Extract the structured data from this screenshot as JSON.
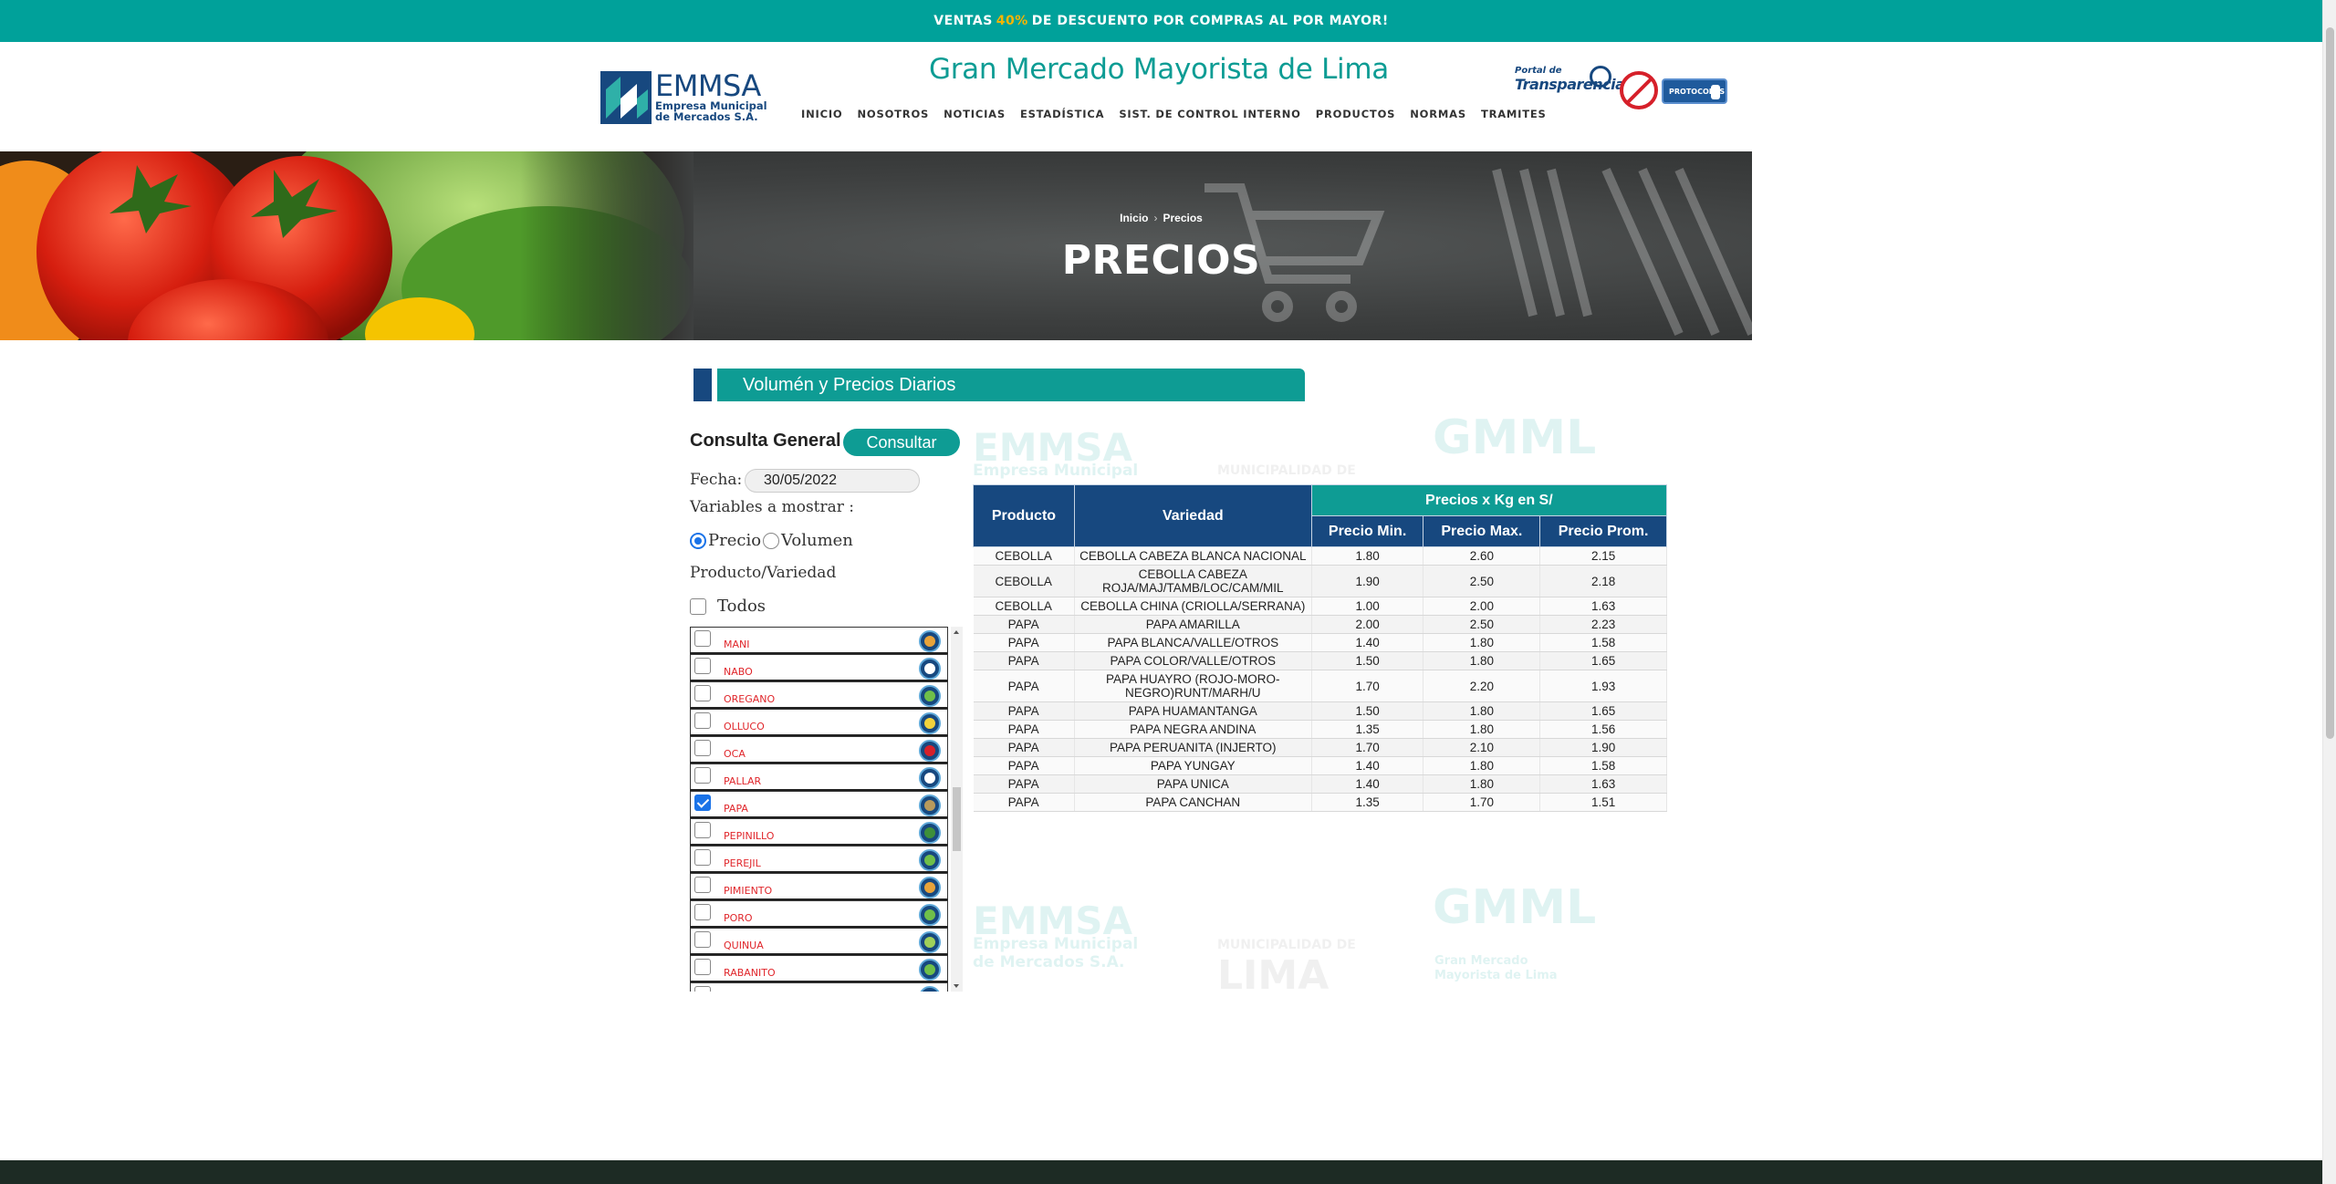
{
  "promo": {
    "pre": "VENTAS",
    "highlight": "40%",
    "post": "DE DESCUENTO POR COMPRAS AL POR MAYOR!"
  },
  "header": {
    "logo_name": "EMMSA",
    "logo_line1": "Empresa Municipal",
    "logo_line2": "de Mercados S.A.",
    "site_title": "Gran Mercado Mayorista de Lima",
    "nav": [
      "INICIO",
      "NOSOTROS",
      "NOTICIAS",
      "ESTADÍSTICA",
      "SIST. DE CONTROL INTERNO",
      "PRODUCTOS",
      "NORMAS",
      "TRAMITES"
    ],
    "portal_small": "Portal de",
    "portal_big": "Transparencia",
    "protocol_label": "PROTOCOLOS"
  },
  "hero": {
    "crumb_home": "Inicio",
    "crumb_current": "Precios",
    "title": "PRECIOS"
  },
  "section_title": "Volumén y Precios Diarios",
  "form": {
    "consulta_label": "Consulta General",
    "consultar_btn": "Consultar",
    "fecha_label": "Fecha:",
    "fecha_value": "30/05/2022",
    "variables_label": "Variables a mostrar :",
    "radio_precio": "Precio",
    "radio_volumen": "Volumen",
    "producto_label": "Producto/Variedad",
    "todos_label": "Todos"
  },
  "products": [
    {
      "name": "MANI",
      "checked": false,
      "color": "#e8a33a"
    },
    {
      "name": "NABO",
      "checked": false,
      "color": "#ffffff"
    },
    {
      "name": "OREGANO",
      "checked": false,
      "color": "#6fbf4a"
    },
    {
      "name": "OLLUCO",
      "checked": false,
      "color": "#f2d23c"
    },
    {
      "name": "OCA",
      "checked": false,
      "color": "#d6202a"
    },
    {
      "name": "PALLAR",
      "checked": false,
      "color": "#ffffff"
    },
    {
      "name": "PAPA",
      "checked": true,
      "color": "#b89a5c"
    },
    {
      "name": "PEPINILLO",
      "checked": false,
      "color": "#3e8f3a"
    },
    {
      "name": "PEREJIL",
      "checked": false,
      "color": "#6fbf4a"
    },
    {
      "name": "PIMIENTO",
      "checked": false,
      "color": "#e8a33a"
    },
    {
      "name": "PORO",
      "checked": false,
      "color": "#6fbf4a"
    },
    {
      "name": "QUINUA",
      "checked": false,
      "color": "#9fd05a"
    },
    {
      "name": "RABANITO",
      "checked": false,
      "color": "#6fbf4a"
    },
    {
      "name": "",
      "checked": false,
      "color": "#6fbf4a"
    }
  ],
  "table": {
    "headers": {
      "producto": "Producto",
      "variedad": "Variedad",
      "group": "Precios x Kg en S/",
      "min": "Precio Min.",
      "max": "Precio Max.",
      "prom": "Precio Prom."
    },
    "rows": [
      [
        "CEBOLLA",
        "CEBOLLA CABEZA BLANCA NACIONAL",
        "1.80",
        "2.60",
        "2.15"
      ],
      [
        "CEBOLLA",
        "CEBOLLA CABEZA ROJA/MAJ/TAMB/LOC/CAM/MIL",
        "1.90",
        "2.50",
        "2.18"
      ],
      [
        "CEBOLLA",
        "CEBOLLA CHINA (CRIOLLA/SERRANA)",
        "1.00",
        "2.00",
        "1.63"
      ],
      [
        "PAPA",
        "PAPA AMARILLA",
        "2.00",
        "2.50",
        "2.23"
      ],
      [
        "PAPA",
        "PAPA BLANCA/VALLE/OTROS",
        "1.40",
        "1.80",
        "1.58"
      ],
      [
        "PAPA",
        "PAPA COLOR/VALLE/OTROS",
        "1.50",
        "1.80",
        "1.65"
      ],
      [
        "PAPA",
        "PAPA HUAYRO (ROJO-MORO-NEGRO)RUNT/MARH/U",
        "1.70",
        "2.20",
        "1.93"
      ],
      [
        "PAPA",
        "PAPA HUAMANTANGA",
        "1.50",
        "1.80",
        "1.65"
      ],
      [
        "PAPA",
        "PAPA NEGRA ANDINA",
        "1.35",
        "1.80",
        "1.56"
      ],
      [
        "PAPA",
        "PAPA PERUANITA (INJERTO)",
        "1.70",
        "2.10",
        "1.90"
      ],
      [
        "PAPA",
        "PAPA YUNGAY",
        "1.40",
        "1.80",
        "1.58"
      ],
      [
        "PAPA",
        "PAPA UNICA",
        "1.40",
        "1.80",
        "1.63"
      ],
      [
        "PAPA",
        "PAPA CANCHAN",
        "1.35",
        "1.70",
        "1.51"
      ]
    ]
  },
  "watermarks": {
    "gmml": "GMML",
    "emmsa": "EMMSA",
    "emmsa_sub1": "Empresa Municipal",
    "emmsa_sub2": "de Mercados S.A.",
    "muni": "MUNICIPALIDAD DE",
    "lima": "LIMA",
    "gmml_sub1": "Gran Mercado",
    "gmml_sub2": "Mayorista de Lima"
  },
  "colors": {
    "teal": "#00a19a",
    "navy": "#17487f",
    "accent": "#f7b500",
    "product_text": "#e0262b"
  }
}
